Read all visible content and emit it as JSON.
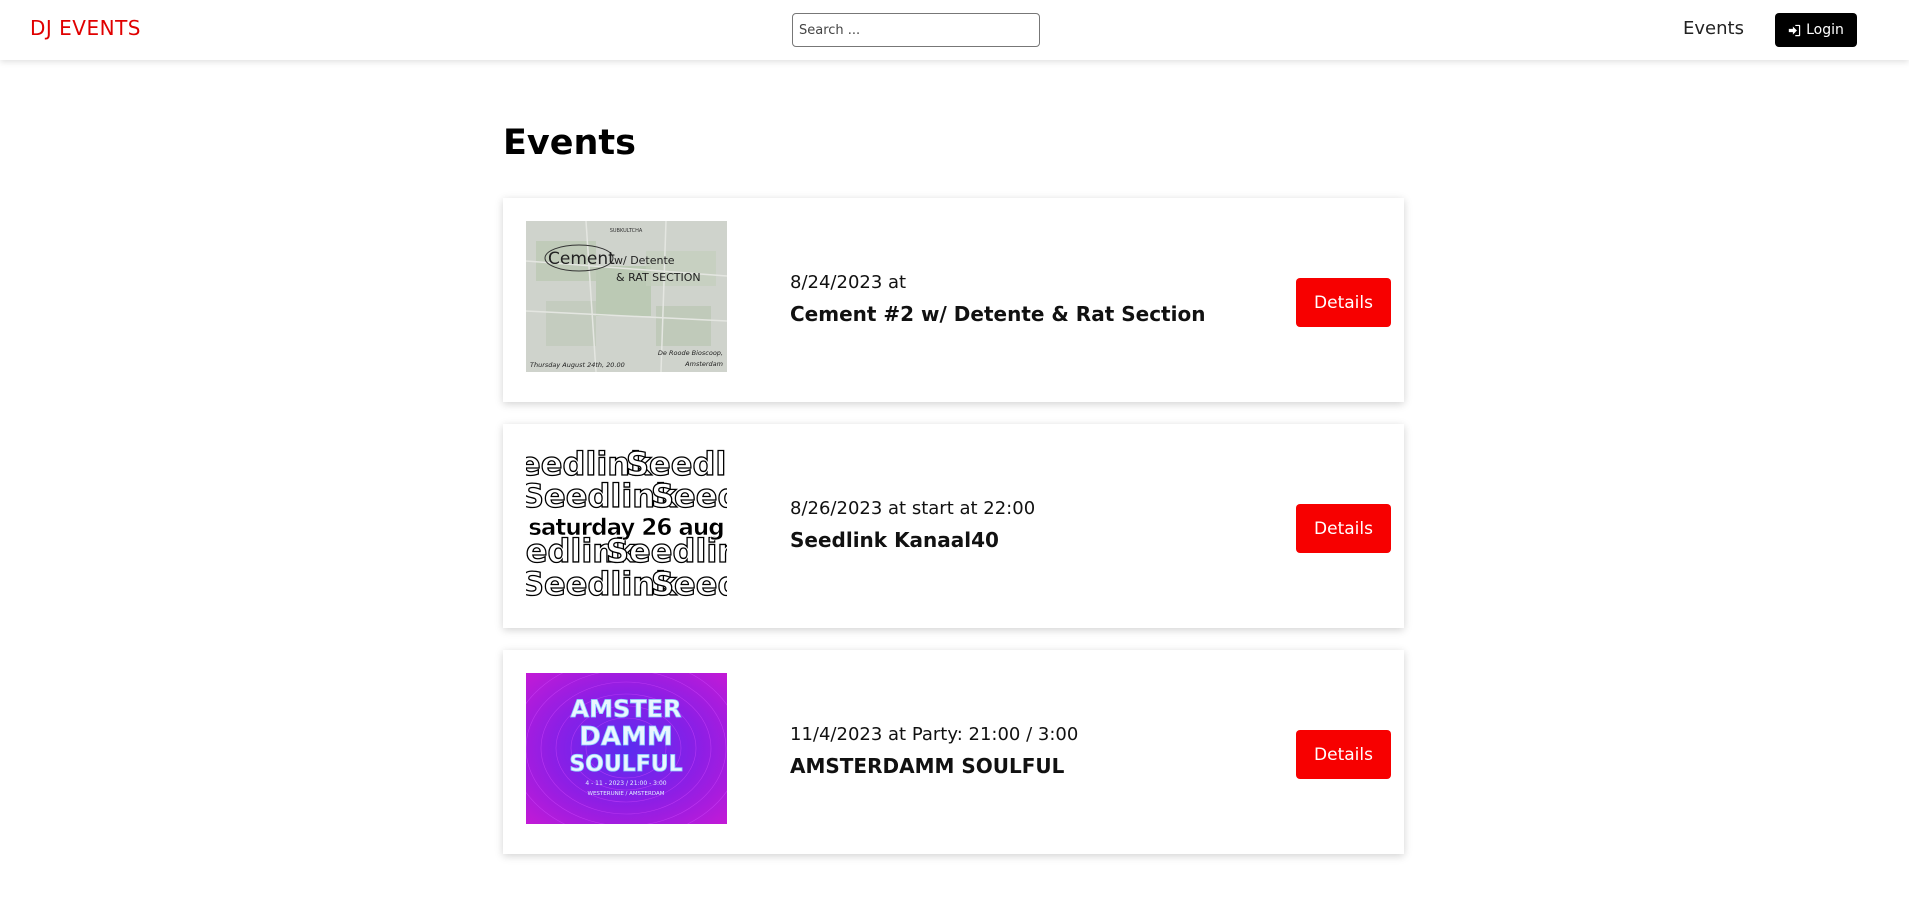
{
  "header": {
    "logo": "DJ EVENTS",
    "search_placeholder": "Search ...",
    "nav_events": "Events",
    "login_label": "Login"
  },
  "main": {
    "title": "Events",
    "events": [
      {
        "date": "8/24/2023 at",
        "name": "Cement #2 w/ Detente & Rat Section",
        "details_label": "Details",
        "poster": {
          "brand": "SUBKULTCHA",
          "title_big": "Cement",
          "title_rest": "w/ Detente",
          "line2": "& RAT SECTION",
          "date_line": "Thursday August 24th, 20.00",
          "venue_line1": "De Roode Bioscoop,",
          "venue_line2": "Amsterdam"
        }
      },
      {
        "date": "8/26/2023 at start at 22:00",
        "name": "Seedlink Kanaal40",
        "details_label": "Details",
        "poster": {
          "pattern_text": "Seedlink",
          "headline": "saturday 26 aug"
        }
      },
      {
        "date": "11/4/2023 at Party: 21:00 / 3:00",
        "name": "AMSTERDAMM SOULFUL",
        "details_label": "Details",
        "poster": {
          "line1": "AMSTER",
          "line2": "DAMM",
          "line3": "SOULFUL",
          "small1": "4 - 11 - 2023 / 21:00 - 3:00",
          "small2": "WESTERUNIE / AMSTERDAM"
        }
      }
    ]
  },
  "colors": {
    "brand_red": "#e00000",
    "button_red": "#f70000",
    "login_bg": "#000000"
  },
  "icons": {
    "login": "sign-in-icon"
  }
}
